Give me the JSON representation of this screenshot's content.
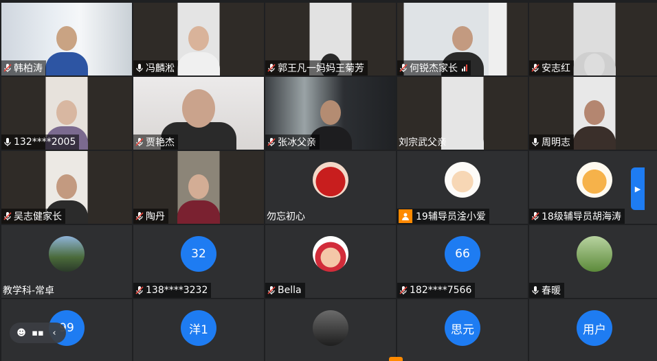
{
  "participants": [
    {
      "name": "韩柏涛",
      "mic": "muted"
    },
    {
      "name": "冯麟淞",
      "mic": "on",
      "active": true
    },
    {
      "name": "郭王凡一妈妈王菊芳",
      "mic": "muted"
    },
    {
      "name": "何锐杰家长",
      "mic": "muted",
      "signal": "weak"
    },
    {
      "name": "安志红",
      "mic": "muted"
    },
    {
      "name": "132****2005",
      "mic": "on"
    },
    {
      "name": "贾艳杰",
      "mic": "muted"
    },
    {
      "name": "张冰父亲",
      "mic": "muted"
    },
    {
      "name": "刘宗武父亲",
      "mic": "none"
    },
    {
      "name": "周明志",
      "mic": "on"
    },
    {
      "name": "吴志健家长",
      "mic": "muted"
    },
    {
      "name": "陶丹",
      "mic": "muted"
    },
    {
      "name": "勿忘初心",
      "mic": "none",
      "avatar": "jersey-14-avatar"
    },
    {
      "name": "19辅导员淦小爱",
      "mic": "none",
      "badge": "person-icon",
      "avatar": "cartoon-girl-avatar"
    },
    {
      "name": "18级辅导员胡海涛",
      "mic": "muted",
      "avatar": "cartoon-tiger-avatar"
    },
    {
      "name": "教学科-常卓",
      "mic": "none",
      "avatar": "group-photo-avatar"
    },
    {
      "name": "138****3232",
      "mic": "muted",
      "avatar_text": "32"
    },
    {
      "name": "Bella",
      "mic": "muted",
      "avatar": "minnie-girl-avatar"
    },
    {
      "name": "182****7566",
      "mic": "muted",
      "avatar_text": "66"
    },
    {
      "name": "春暖",
      "mic": "on",
      "avatar": "garden-avatar"
    },
    {
      "name": "",
      "avatar_text": "99"
    },
    {
      "name": "",
      "avatar_text": "洋1"
    },
    {
      "name": "",
      "avatar": "dark-photo-avatar"
    },
    {
      "name": "",
      "avatar_text": "思元"
    },
    {
      "name": "",
      "avatar_text": "用户"
    }
  ],
  "colors": {
    "background": "#1f2022",
    "tile": "#2e2f31",
    "active_border": "#2fb64d",
    "avatar_blue": "#1e7cf2",
    "mic_muted": "#e8453c",
    "badge_orange": "#ff8a00"
  },
  "controls": {
    "side_arrow_icon": "chevron-right-icon",
    "toolbar_icons": [
      "emoji-icon",
      "chat-icon",
      "chevron-left-icon"
    ]
  }
}
